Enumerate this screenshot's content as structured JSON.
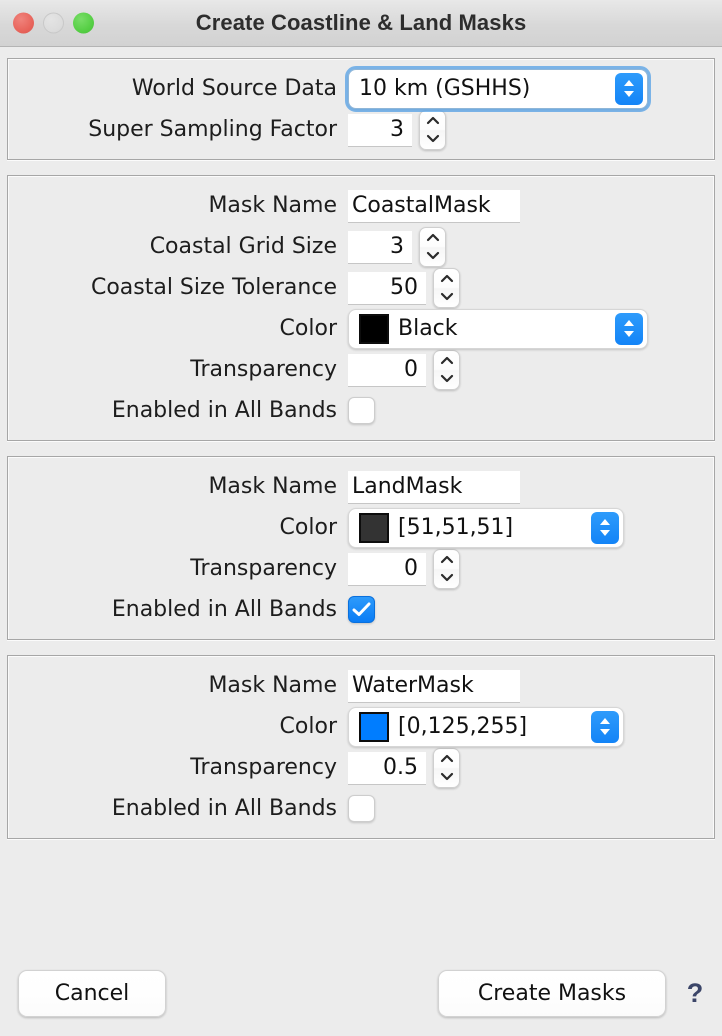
{
  "window": {
    "title": "Create Coastline & Land Masks",
    "traffic_lights": [
      {
        "name": "close",
        "color": "#e8655c",
        "enabled": true
      },
      {
        "name": "minimize",
        "color": "#dcdcdc",
        "enabled": false
      },
      {
        "name": "zoom",
        "color": "#56cf45",
        "enabled": true
      }
    ]
  },
  "source_group": {
    "world_source_data": {
      "label": "World Source Data",
      "value": "10 km (GSHHS)",
      "focused": true
    },
    "super_sampling_factor": {
      "label": "Super Sampling Factor",
      "value": "3"
    }
  },
  "coastal_mask": {
    "mask_name": {
      "label": "Mask Name",
      "value": "CoastalMask"
    },
    "grid_size": {
      "label": "Coastal Grid Size",
      "value": "3"
    },
    "tolerance": {
      "label": "Coastal Size Tolerance",
      "value": "50"
    },
    "color": {
      "label": "Color",
      "value": "Black",
      "swatch": "#000000"
    },
    "transparency": {
      "label": "Transparency",
      "value": "0"
    },
    "enabled": {
      "label": "Enabled in All Bands",
      "checked": false
    }
  },
  "land_mask": {
    "mask_name": {
      "label": "Mask Name",
      "value": "LandMask"
    },
    "color": {
      "label": "Color",
      "value": "[51,51,51]",
      "swatch": "#333333"
    },
    "transparency": {
      "label": "Transparency",
      "value": "0"
    },
    "enabled": {
      "label": "Enabled in All Bands",
      "checked": true
    }
  },
  "water_mask": {
    "mask_name": {
      "label": "Mask Name",
      "value": "WaterMask"
    },
    "color": {
      "label": "Color",
      "value": "[0,125,255]",
      "swatch": "#007dff"
    },
    "transparency": {
      "label": "Transparency",
      "value": "0.5"
    },
    "enabled": {
      "label": "Enabled in All Bands",
      "checked": false
    }
  },
  "footer": {
    "cancel_label": "Cancel",
    "create_label": "Create Masks",
    "help_glyph": "?"
  },
  "theme": {
    "accent": "#0a7cf5",
    "window_bg": "#ececec",
    "text": "#1d1d1d"
  }
}
